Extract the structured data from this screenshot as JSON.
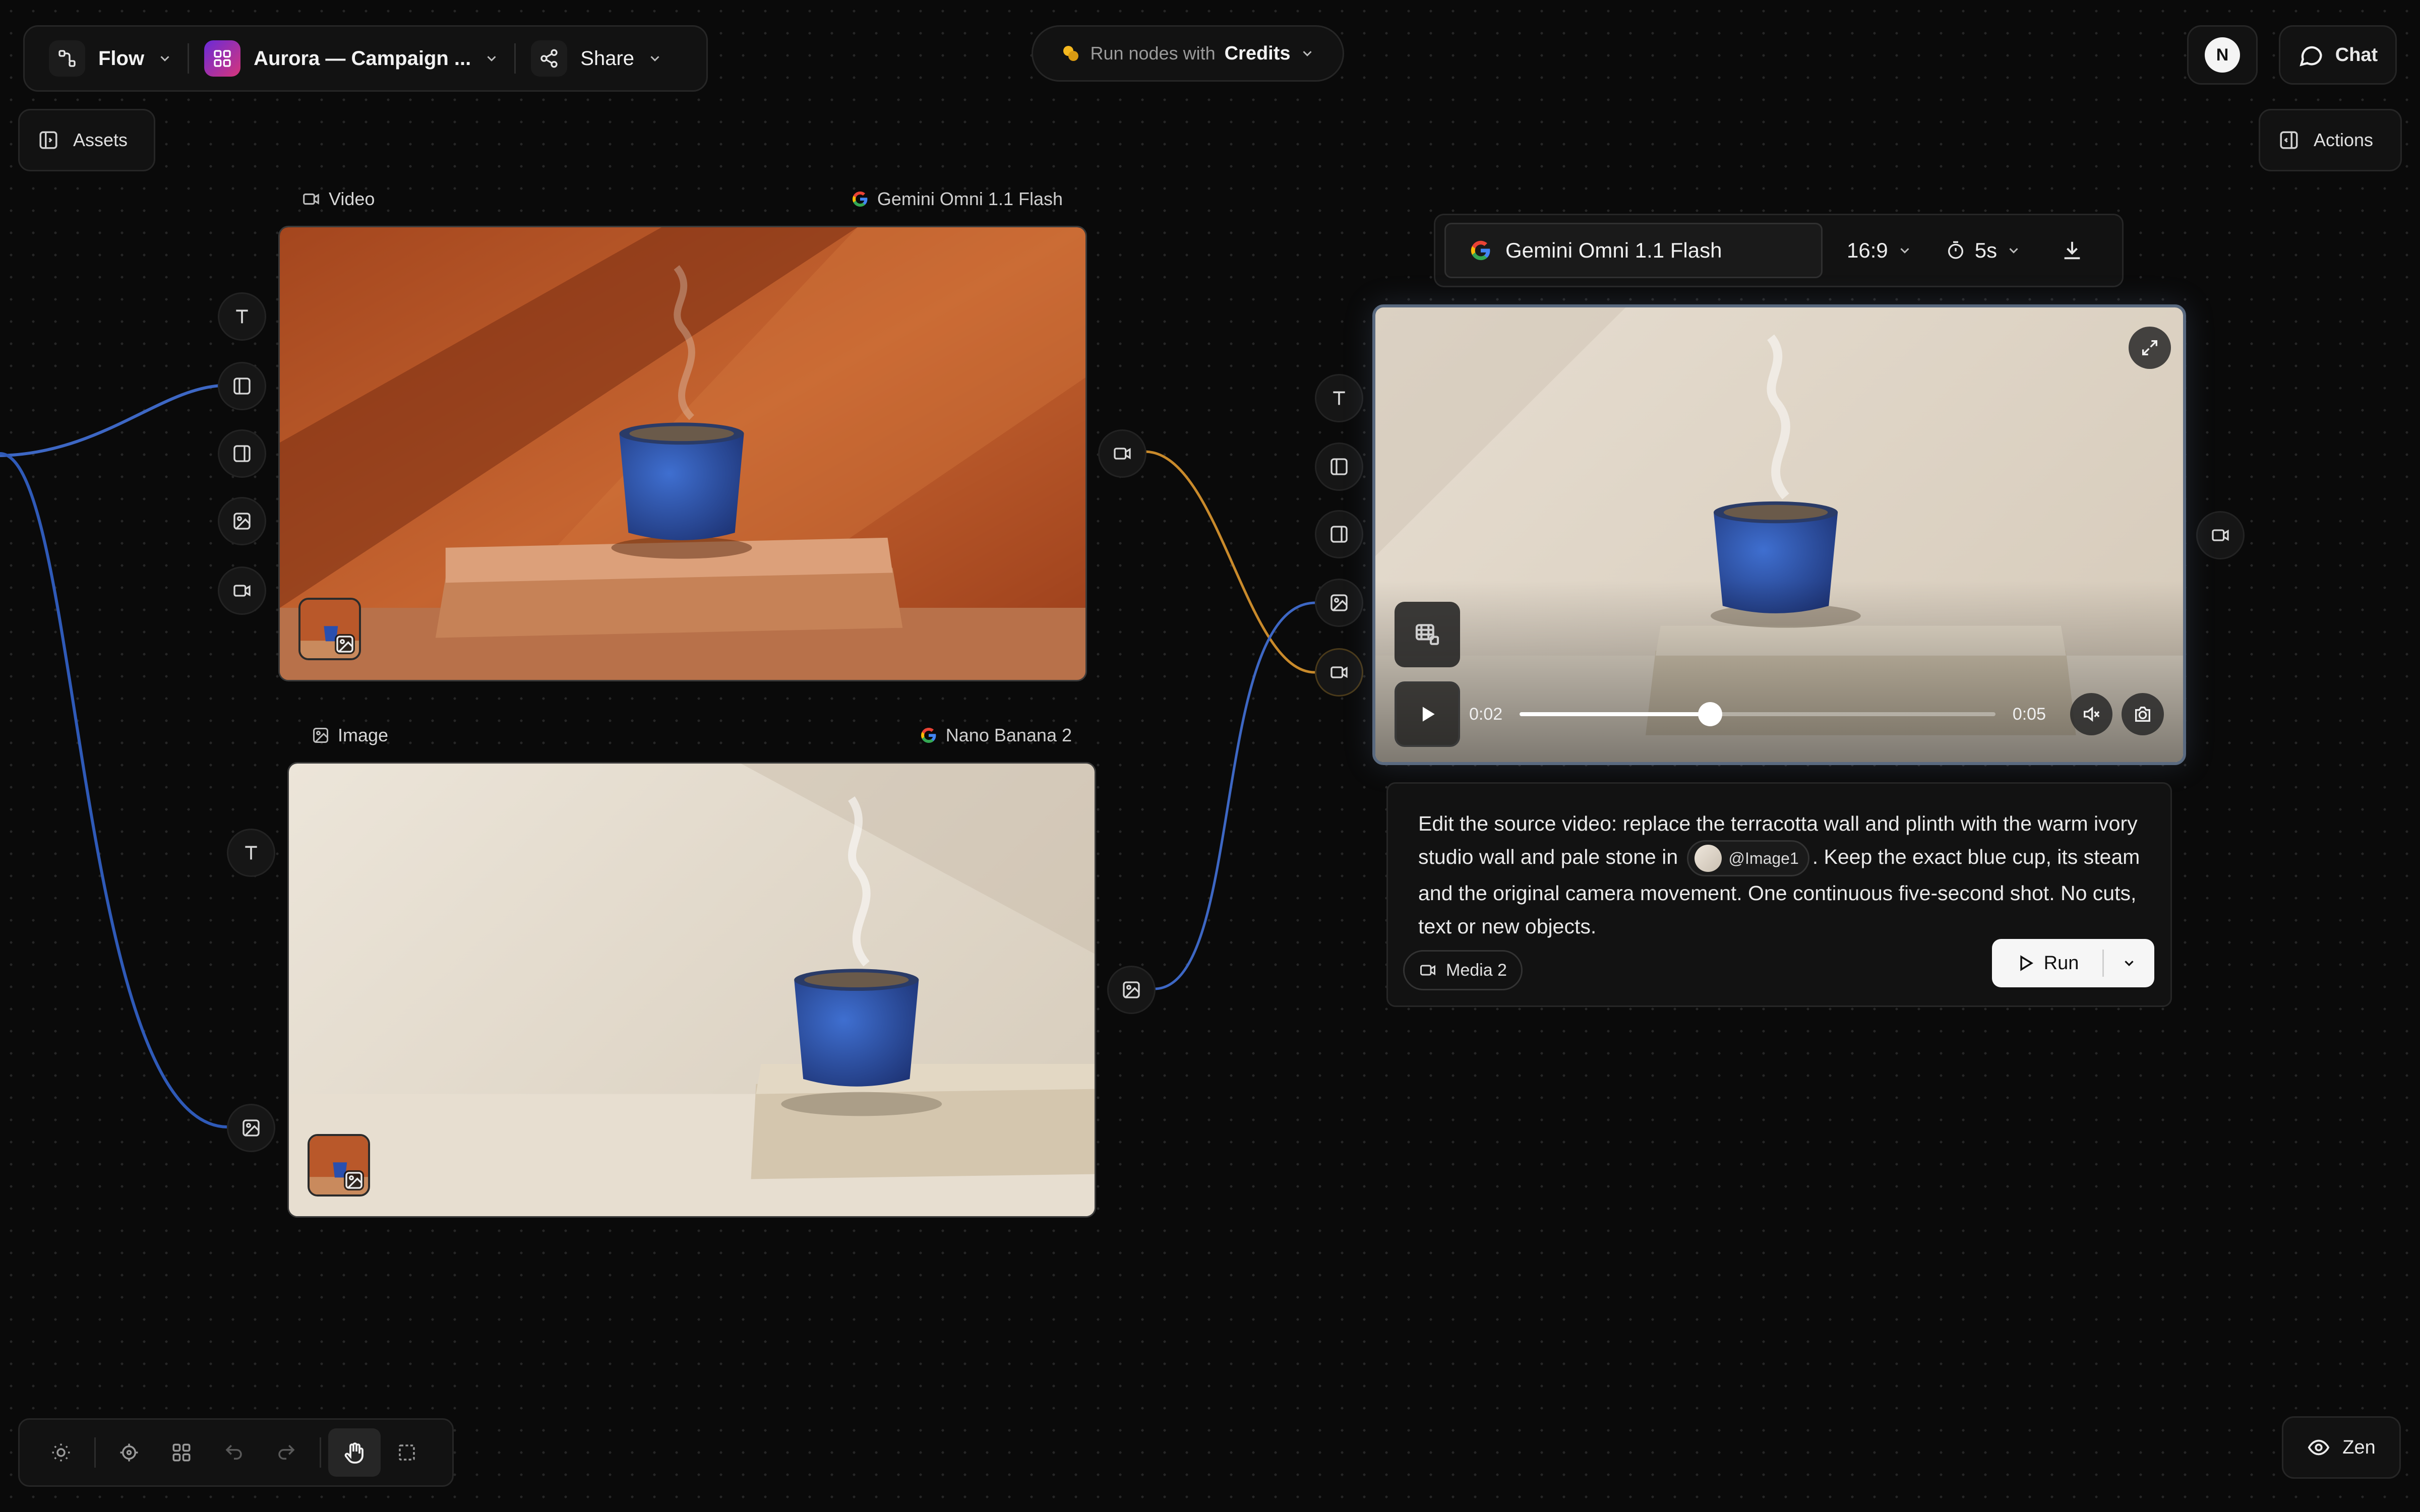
{
  "topbar": {
    "flow_label": "Flow",
    "project_label": "Aurora — Campaign ...",
    "share_label": "Share"
  },
  "credits": {
    "prefix": "Run nodes with",
    "value": "Credits",
    "coin_color": "#f5b81f"
  },
  "user": {
    "avatar_initial": "N"
  },
  "chat": {
    "label": "Chat"
  },
  "assets": {
    "label": "Assets"
  },
  "actions": {
    "label": "Actions"
  },
  "video_node": {
    "type_label": "Video",
    "model": "Gemini Omni 1.1 Flash"
  },
  "image_node": {
    "type_label": "Image",
    "model": "Nano Banana 2"
  },
  "generator": {
    "model": "Gemini Omni 1.1 Flash",
    "aspect_ratio": "16:9",
    "duration": "5s",
    "player": {
      "current_time": "0:02",
      "total_time": "0:05",
      "progress": 0.4,
      "muted": true
    },
    "prompt": {
      "before_mention": "Edit the source video: replace the terracotta wall and plinth with the warm ivory studio wall and pale stone in",
      "mention": "@Image1",
      "after_mention": ". Keep the exact blue cup, its steam and the original camera movement. One continuous five-second shot. No cuts, text or new objects."
    },
    "media_chip": "Media 2",
    "run_label": "Run"
  },
  "zen": {
    "label": "Zen"
  },
  "colors": {
    "wire_blue": "#3d67c4",
    "wire_orange": "#c98a2b",
    "background": "#0a0a0a"
  }
}
